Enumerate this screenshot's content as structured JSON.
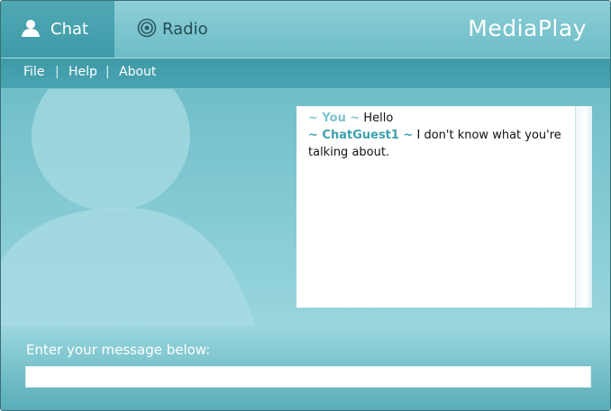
{
  "tabs": [
    {
      "label": "Chat",
      "icon": "user-icon",
      "active": true
    },
    {
      "label": "Radio",
      "icon": "radio-target-icon",
      "active": false
    }
  ],
  "brand": "MediaPlay",
  "menu": [
    "File",
    "Help",
    "About"
  ],
  "menu_separator": "|",
  "chat": {
    "messages": [
      {
        "prefix": "~ You ~",
        "text": " Hello",
        "sender_style": "you"
      },
      {
        "prefix": "~ ChatGuest1 ~",
        "text": " I don't know what you're talking about.",
        "sender_style": "guest"
      }
    ]
  },
  "compose": {
    "prompt": "Enter your message below:",
    "value": ""
  },
  "colors": {
    "accent": "#3f9aa7",
    "you_name": "#7fc4cf",
    "guest_name": "#3da1ae"
  }
}
